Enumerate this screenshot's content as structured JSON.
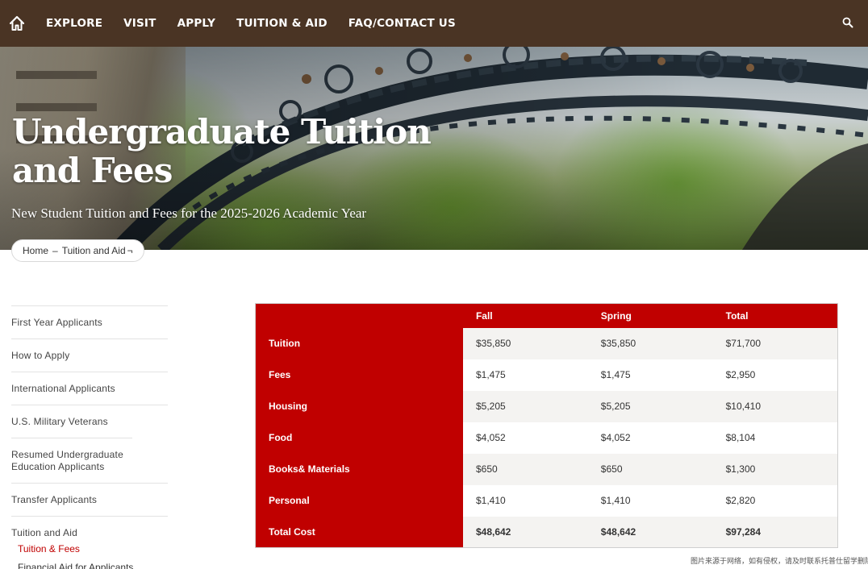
{
  "nav": {
    "items": [
      "EXPLORE",
      "VISIT",
      "APPLY",
      "TUITION & AID",
      "FAQ/CONTACT US"
    ],
    "icons": {
      "home": "home-icon",
      "search": "search-icon"
    },
    "bg_color": "#4a3424"
  },
  "hero": {
    "title": "Undergraduate Tuition and Fees",
    "subtitle": "New Student Tuition and Fees for the 2025-2026 Academic Year"
  },
  "breadcrumb": {
    "home": "Home",
    "separator": "–",
    "current": "Tuition and Aid",
    "trailing": "¬"
  },
  "sidebar": {
    "items": [
      "First Year Applicants",
      "How to Apply",
      "International Applicants",
      "U.S. Military Veterans",
      "Resumed Undergraduate Education Applicants",
      "Transfer Applicants"
    ],
    "parent": "Tuition and Aid",
    "subitems": [
      "Tuition & Fees",
      "Financial Aid for Applicants"
    ],
    "active_subitem": "Tuition & Fees",
    "accent_color": "#c00000"
  },
  "table": {
    "headers": [
      "",
      "Fall",
      "Spring",
      "Total"
    ],
    "rows": [
      {
        "label": "Tuition",
        "fall": "$35,850",
        "spring": "$35,850",
        "total": "$71,700"
      },
      {
        "label": "Fees",
        "fall": "$1,475",
        "spring": "$1,475",
        "total": "$2,950"
      },
      {
        "label": "Housing",
        "fall": "$5,205",
        "spring": "$5,205",
        "total": "$10,410"
      },
      {
        "label": "Food",
        "fall": "$4,052",
        "spring": "$4,052",
        "total": "$8,104"
      },
      {
        "label": "Books& Materials",
        "fall": "$650",
        "spring": "$650",
        "total": "$1,300"
      },
      {
        "label": "Personal",
        "fall": "$1,410",
        "spring": "$1,410",
        "total": "$2,820"
      },
      {
        "label": "Total Cost",
        "fall": "$48,642",
        "spring": "$48,642",
        "total": "$97,284"
      }
    ],
    "header_color": "#c00000"
  },
  "watermark": "图片来源于网络，如有侵权，请及时联系托普仕留学删除"
}
